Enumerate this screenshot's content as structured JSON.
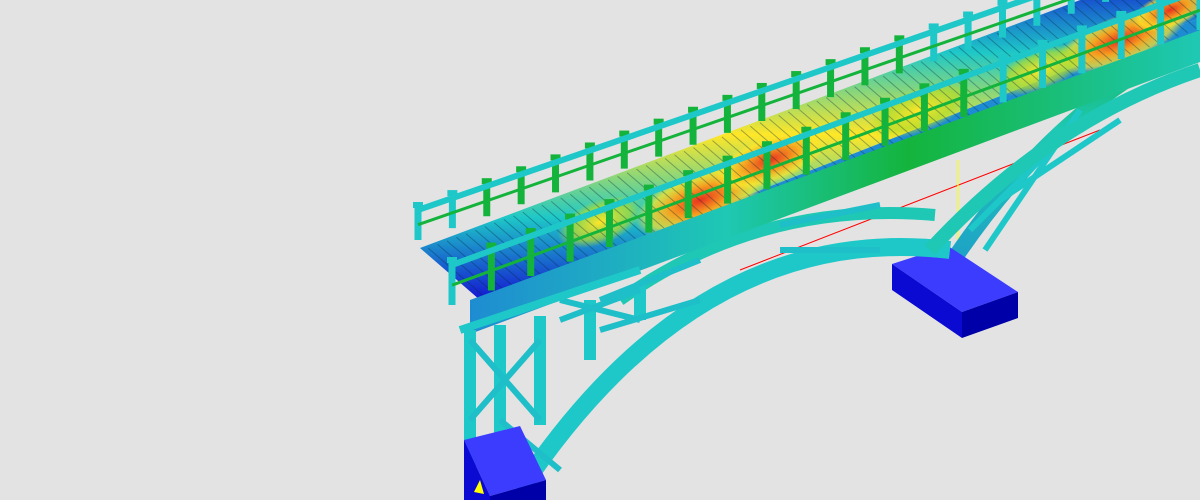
{
  "scene": {
    "background": "#e3e3e3",
    "subject-icon": "bridge-icon",
    "colormap": {
      "low": "#1414d2",
      "low_mid": "#1ec8c8",
      "mid": "#14b43c",
      "high_mid": "#ffe628",
      "high": "#e8321e"
    },
    "pier_color": "#0a0ad2",
    "axis_colors": {
      "x_axis": "#ff0000",
      "y_axis": "#ffff00",
      "z_axis": "#00c800"
    }
  }
}
